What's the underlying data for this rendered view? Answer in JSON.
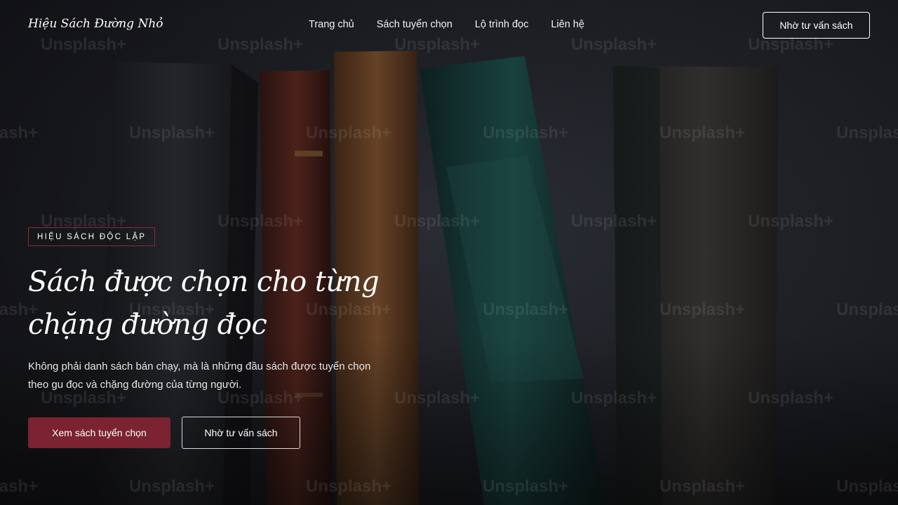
{
  "header": {
    "brand": "Hiệu Sách Đường Nhỏ",
    "nav": [
      "Trang chủ",
      "Sách tuyển chọn",
      "Lộ trình đọc",
      "Liên hệ"
    ],
    "cta_label": "Nhờ tư vấn sách"
  },
  "hero": {
    "eyebrow": "HIỆU SÁCH ĐỘC LẬP",
    "title_line1": "Sách được chọn cho từng",
    "title_line2": "chặng đường đọc",
    "subtitle_line1": "Không phải danh sách bán chạy, mà là những đầu sách được tuyển chọn",
    "subtitle_line2": "theo gu đọc và chặng đường của từng người.",
    "primary_button": "Xem sách tuyển chọn",
    "secondary_button": "Nhờ tư vấn sách"
  },
  "background": {
    "image": "stack-of-old-books",
    "watermark_text": "Unsplash+"
  },
  "colors": {
    "accent": "#7b2330",
    "eyebrow_border": "#8a2a35",
    "text": "#ffffff"
  }
}
